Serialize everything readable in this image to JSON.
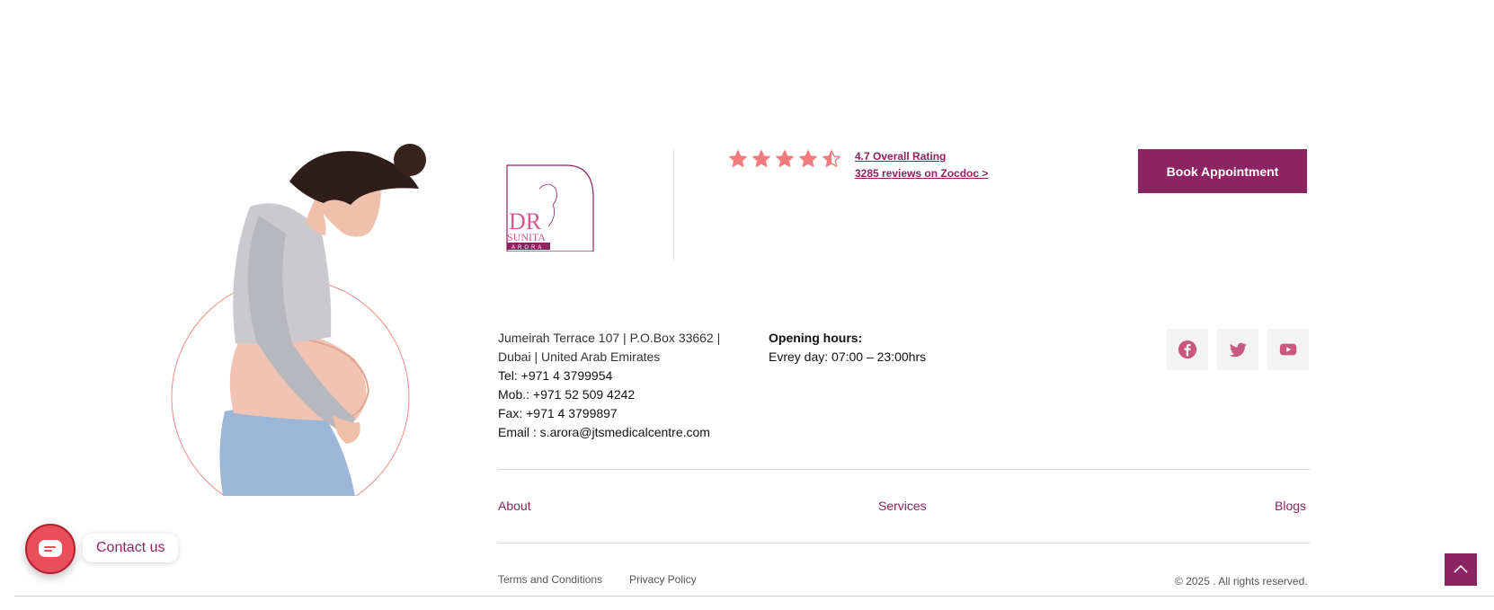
{
  "rating": {
    "stars": 4.5,
    "star_color": "#f27b7f",
    "overall_label": "4.7 Overall Rating",
    "reviews_label": "3285 reviews on Zocdoc >"
  },
  "header": {
    "book_button": "Book Appointment"
  },
  "logo": {
    "line1": "DR",
    "line2": "SUNITA",
    "line3": "ARORA"
  },
  "contact": {
    "address_line1": "Jumeirah Terrace 107 | P.O.Box 33662 |",
    "address_line2": "Dubai | United Arab Emirates",
    "tel": "Tel: +971 4 3799954",
    "mob": "Mob.: +971 52 509 4242",
    "fax": "Fax: +971 4 3799897",
    "email": "Email : s.arora@jtsmedicalcentre.com"
  },
  "hours": {
    "title": "Opening hours:",
    "value": "Evrey day: 07:00 – 23:00hrs"
  },
  "social": {
    "icons": [
      "facebook-icon",
      "twitter-icon",
      "youtube-icon"
    ],
    "icon_color": "#c9577f"
  },
  "footer_nav": {
    "about": "About",
    "services": "Services",
    "blogs": "Blogs"
  },
  "legal": {
    "terms": "Terms and Conditions",
    "privacy": "Privacy Policy",
    "copyright": "© 2025 . All rights reserved."
  },
  "widget": {
    "contact_label": "Contact us"
  },
  "colors": {
    "brand": "#8b2460",
    "accent": "#e84f5b"
  }
}
